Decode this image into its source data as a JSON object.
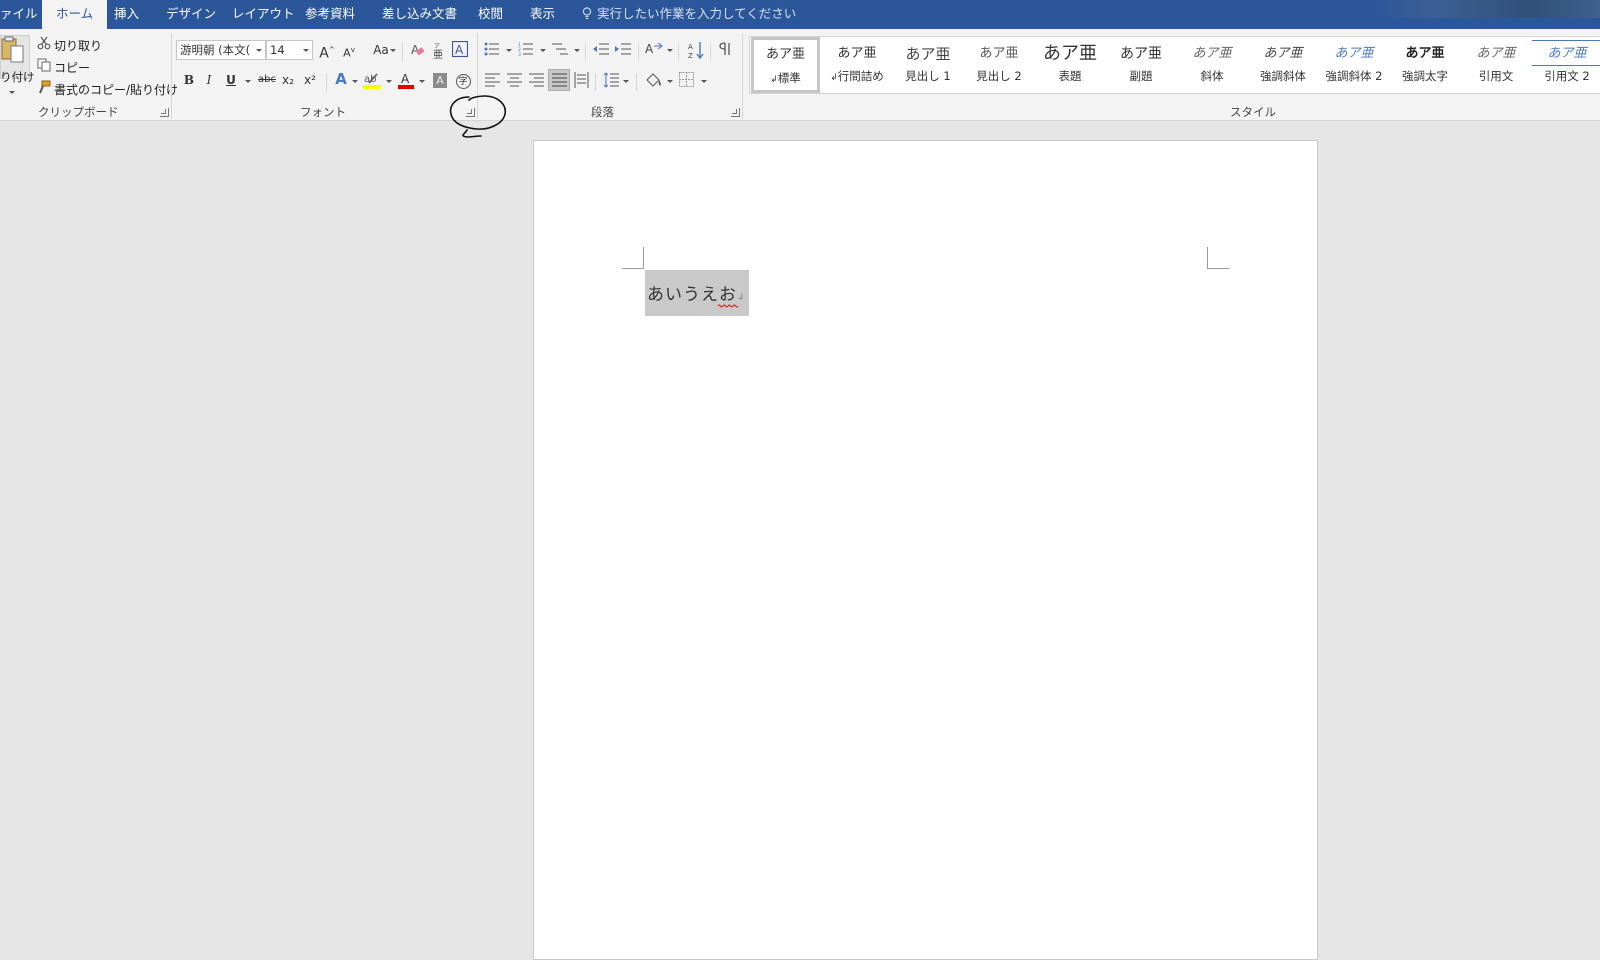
{
  "tabs": {
    "file": "ァイル",
    "home": "ホーム",
    "insert": "挿入",
    "design": "デザイン",
    "layout": "レイアウト",
    "references": "参考資料",
    "mailings": "差し込み文書",
    "review": "校閲",
    "view": "表示",
    "tell_me": "実行したい作業を入力してください"
  },
  "clipboard": {
    "paste": "り付け",
    "cut": "切り取り",
    "copy": "コピー",
    "format_painter": "書式のコピー/貼り付け",
    "group_label": "クリップボード"
  },
  "font": {
    "font_name": "游明朝 (本文(",
    "font_size": "14",
    "grow": "A",
    "shrink": "A",
    "change_case": "Aa",
    "bold": "B",
    "italic": "I",
    "underline": "U",
    "strikethrough": "abc",
    "subscript": "x₂",
    "superscript": "x²",
    "text_effects": "A",
    "font_color": "A",
    "char_shading": "A",
    "enclose": "字",
    "group_label": "フォント"
  },
  "paragraph": {
    "group_label": "段落"
  },
  "styles": {
    "group_label": "スタイル",
    "sample": "あア亜",
    "items": [
      {
        "name": "標準",
        "mark": "↲"
      },
      {
        "name": "行間詰め",
        "mark": "↲"
      },
      {
        "name": "見出し 1",
        "mark": ""
      },
      {
        "name": "見出し 2",
        "mark": ""
      },
      {
        "name": "表題",
        "mark": ""
      },
      {
        "name": "副題",
        "mark": ""
      },
      {
        "name": "斜体",
        "mark": ""
      },
      {
        "name": "強調斜体",
        "mark": ""
      },
      {
        "name": "強調斜体 2",
        "mark": ""
      },
      {
        "name": "強調太字",
        "mark": ""
      },
      {
        "name": "引用文",
        "mark": ""
      },
      {
        "name": "引用文 2",
        "mark": ""
      }
    ]
  },
  "document": {
    "text": "あいうえお",
    "paragraph_mark": "↲"
  },
  "colors": {
    "title_bar": "#2b579a",
    "ribbon": "#f3f3f3",
    "workspace": "#e6e6e6",
    "selection": "#c9c9c9",
    "highlight": "#ffff00",
    "font_color": "#e00000",
    "accent_blue": "#4a78c2"
  }
}
